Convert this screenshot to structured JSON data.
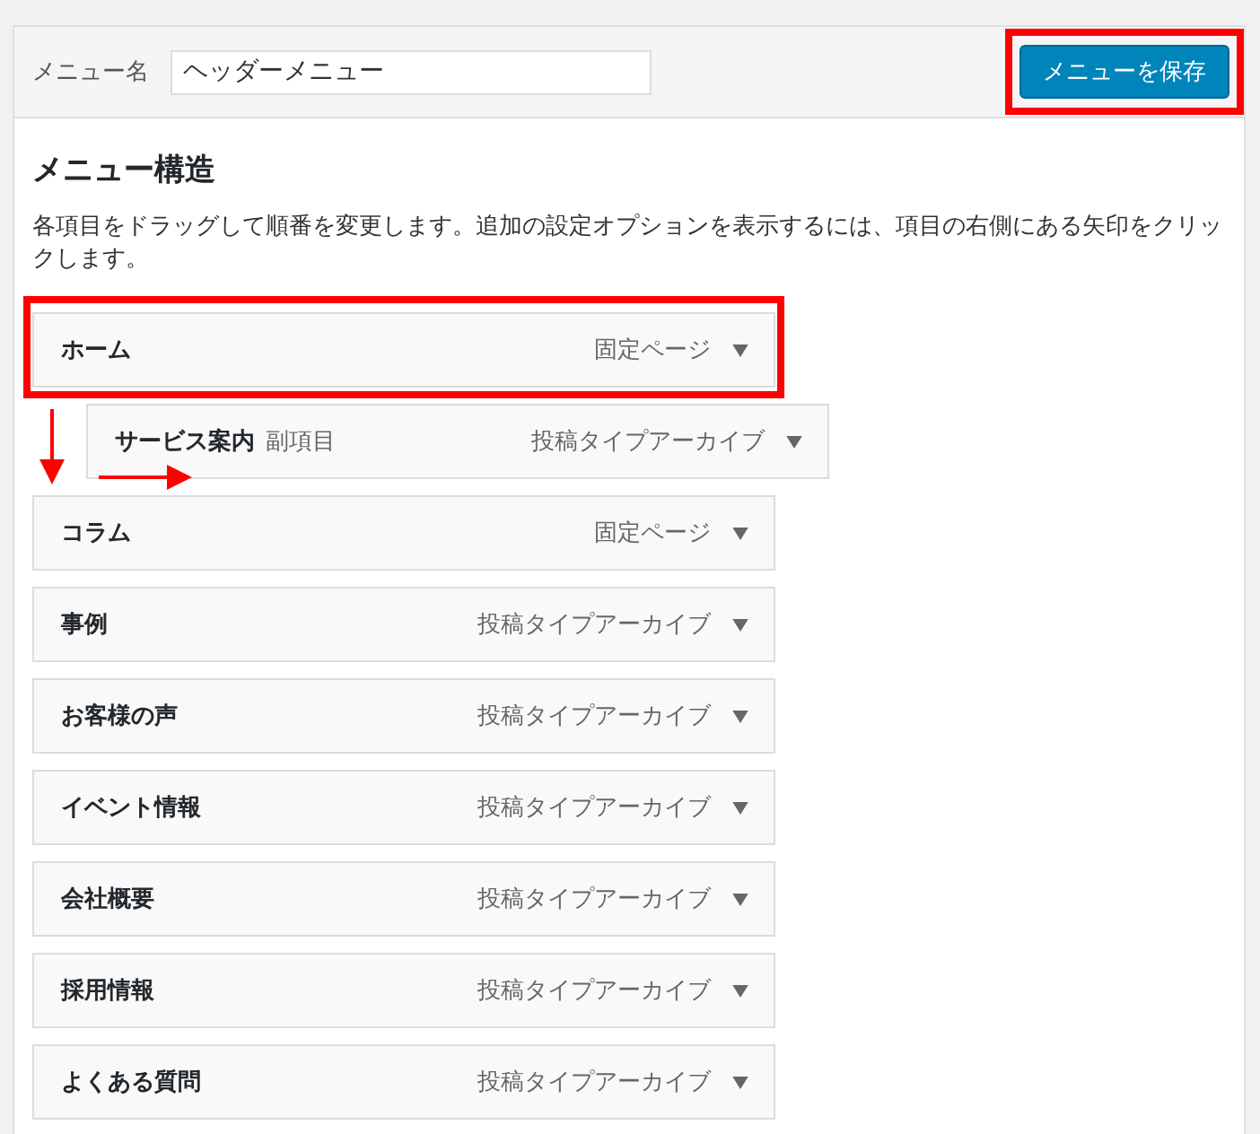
{
  "menu_name": {
    "label": "メニュー名",
    "value": "ヘッダーメニュー"
  },
  "save_button": {
    "label": "メニューを保存",
    "highlighted": true
  },
  "structure": {
    "title": "メニュー構造",
    "description": "各項目をドラッグして順番を変更します。追加の設定オプションを表示するには、項目の右側にある矢印をクリックします。"
  },
  "items": [
    {
      "title": "ホーム",
      "type": "固定ページ",
      "highlighted": true,
      "children": [
        {
          "title": "サービス案内",
          "sub_label": "副項目",
          "type": "投稿タイプアーカイブ",
          "highlighted": false
        }
      ]
    },
    {
      "title": "コラム",
      "type": "固定ページ",
      "highlighted": false
    },
    {
      "title": "事例",
      "type": "投稿タイプアーカイブ",
      "highlighted": false
    },
    {
      "title": "お客様の声",
      "type": "投稿タイプアーカイブ",
      "highlighted": false
    },
    {
      "title": "イベント情報",
      "type": "投稿タイプアーカイブ",
      "highlighted": false
    },
    {
      "title": "会社概要",
      "type": "投稿タイプアーカイブ",
      "highlighted": false
    },
    {
      "title": "採用情報",
      "type": "投稿タイプアーカイブ",
      "highlighted": false
    },
    {
      "title": "よくある質問",
      "type": "投稿タイプアーカイブ",
      "highlighted": false
    }
  ]
}
